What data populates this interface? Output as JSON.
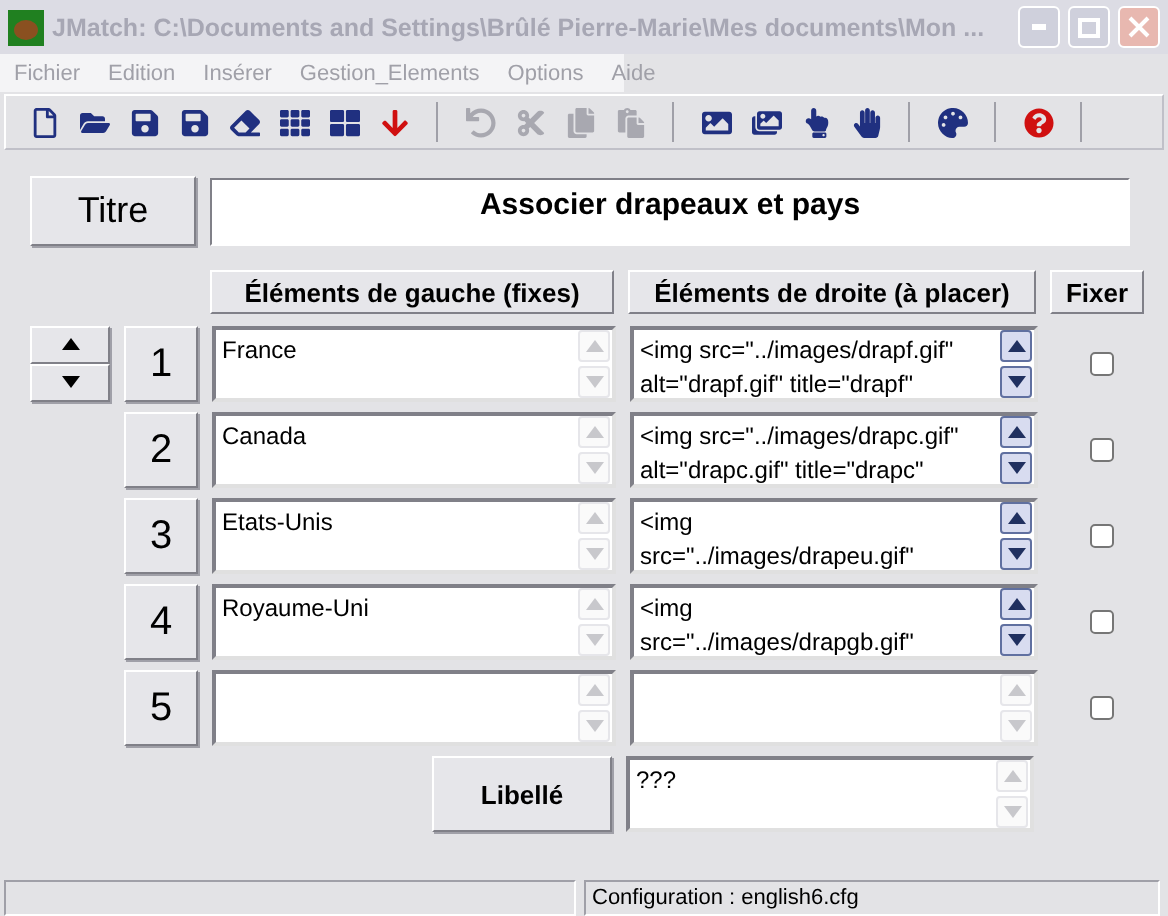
{
  "window": {
    "title": "JMatch: C:\\Documents and Settings\\Brûlé Pierre-Marie\\Mes documents\\Mon ...",
    "active": false
  },
  "menu": [
    "Fichier",
    "Edition",
    "Insérer",
    "Gestion_Elements",
    "Options",
    "Aide"
  ],
  "toolbar": [
    [
      {
        "disabled": false
      },
      {
        "disabled": false
      },
      {
        "disabled": false
      },
      {
        "disabled": false
      },
      {
        "disabled": false
      },
      {
        "disabled": false
      },
      {
        "disabled": false
      },
      {
        "disabled": false
      }
    ],
    [
      {
        "disabled": true
      },
      {
        "disabled": true
      },
      {
        "disabled": true
      },
      {
        "disabled": true
      }
    ],
    [
      {
        "disabled": false
      },
      {
        "disabled": false
      },
      {
        "disabled": false
      },
      {
        "disabled": false
      }
    ],
    [
      {
        "disabled": false
      }
    ],
    [
      {
        "disabled": false
      }
    ]
  ],
  "title_button": "Titre",
  "title_value": "Associer drapeaux et pays",
  "headers": {
    "left": "Éléments de gauche (fixes)",
    "right": "Éléments de droite (à placer)",
    "fix": "Fixer"
  },
  "rows": [
    {
      "number": "1",
      "left": "France",
      "right": "<img src=\"../images/drapf.gif\" alt=\"drapf.gif\" title=\"drapf\"",
      "right_scrollable": true,
      "fixed": false
    },
    {
      "number": "2",
      "left": "Canada",
      "right": "<img src=\"../images/drapc.gif\" alt=\"drapc.gif\" title=\"drapc\"",
      "right_scrollable": true,
      "fixed": false
    },
    {
      "number": "3",
      "left": "Etats-Unis",
      "right": "<img\nsrc=\"../images/drapeu.gif\"",
      "right_scrollable": true,
      "fixed": false
    },
    {
      "number": "4",
      "left": "Royaume-Uni",
      "right": "<img\nsrc=\"../images/drapgb.gif\"",
      "right_scrollable": true,
      "fixed": false
    },
    {
      "number": "5",
      "left": "",
      "right": "",
      "right_scrollable": false,
      "fixed": false
    }
  ],
  "label_button": "Libellé",
  "label_value": "???",
  "status_bar": {
    "config": "Configuration : english6.cfg"
  }
}
